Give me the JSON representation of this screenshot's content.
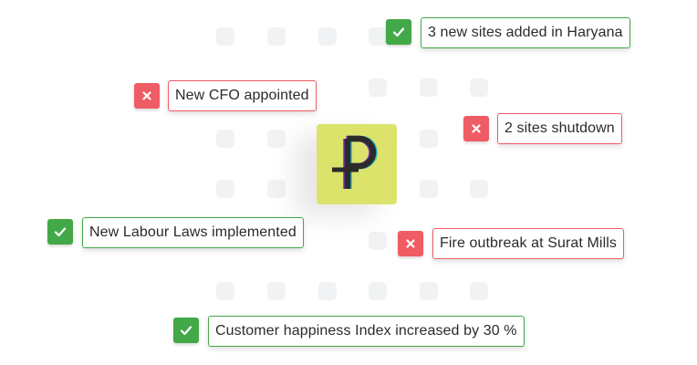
{
  "colors": {
    "success": "#43a848",
    "error": "#f05c64",
    "logo_background": "#dbe36b",
    "logo_mark": "#2b2b2b"
  },
  "logo": {
    "icon": "rupee-p-logo"
  },
  "events": [
    {
      "text": "3 new sites added in Haryana",
      "status": "positive",
      "icon": "check-icon"
    },
    {
      "text": "New CFO appointed",
      "status": "negative",
      "icon": "close-icon"
    },
    {
      "text": "2 sites shutdown",
      "status": "negative",
      "icon": "close-icon"
    },
    {
      "text": "New Labour Laws implemented",
      "status": "positive",
      "icon": "check-icon"
    },
    {
      "text": "Fire outbreak at Surat Mills",
      "status": "negative",
      "icon": "close-icon"
    },
    {
      "text": "Customer happiness Index increased by 30 %",
      "status": "positive",
      "icon": "check-icon"
    }
  ]
}
